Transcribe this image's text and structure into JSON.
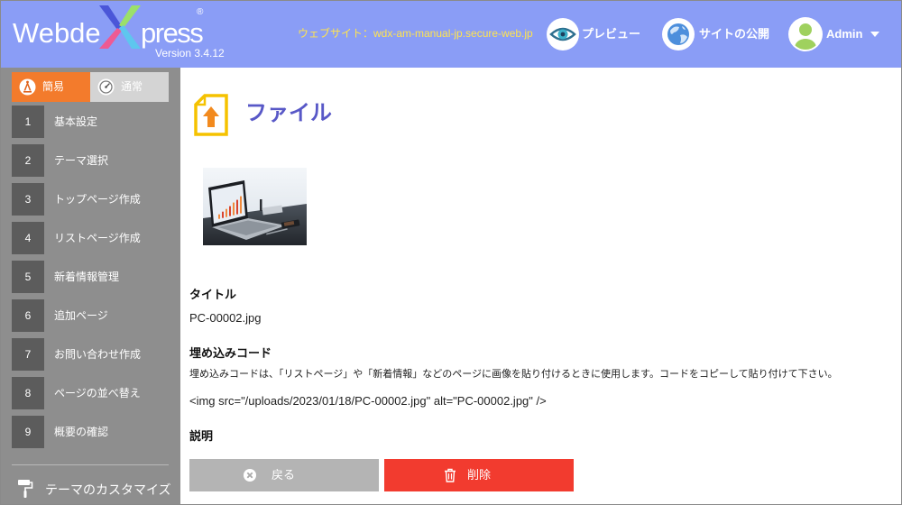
{
  "header": {
    "logo": {
      "left": "Webde",
      "mark": "X",
      "right": "press",
      "trademark": "®",
      "version": "Version 3.4.12"
    },
    "website": "ウェブサイト：wdx-am-manual-jp.secure-web.jp",
    "preview": "プレビュー",
    "publish": "サイトの公開",
    "user": "Admin"
  },
  "sidebar": {
    "modes": [
      {
        "label": "簡易",
        "active": true,
        "icon": "easy-mode-icon"
      },
      {
        "label": "通常",
        "active": false,
        "icon": "normal-mode-icon"
      }
    ],
    "items": [
      {
        "num": "1",
        "label": "基本設定"
      },
      {
        "num": "2",
        "label": "テーマ選択"
      },
      {
        "num": "3",
        "label": "トップページ作成"
      },
      {
        "num": "4",
        "label": "リストページ作成"
      },
      {
        "num": "5",
        "label": "新着情報管理"
      },
      {
        "num": "6",
        "label": "追加ページ"
      },
      {
        "num": "7",
        "label": "お問い合わせ作成"
      },
      {
        "num": "8",
        "label": "ページの並べ替え"
      },
      {
        "num": "9",
        "label": "概要の確認"
      }
    ],
    "customize": {
      "label": "テーマのカスタマイズ",
      "icon": "paint-roller-icon"
    }
  },
  "main": {
    "page_title": "ファイル",
    "page_icon": "file-upload-icon",
    "title_heading": "タイトル",
    "title_value": "PC-00002.jpg",
    "embed_heading": "埋め込みコード",
    "embed_help": "埋め込みコードは、「リストページ」や「新着情報」などのページに画像を貼り付けるときに使用します。コードをコピーして貼り付けて下さい。",
    "embed_code": "<img src=\"/uploads/2023/01/18/PC-00002.jpg\" alt=\"PC-00002.jpg\" />",
    "description_heading": "説明",
    "back_button": "戻る",
    "delete_button": "削除"
  },
  "icons": {
    "preview": "eye-icon",
    "publish": "globe-icon",
    "user": "avatar-icon",
    "user_menu": "caret-down-icon",
    "back": "close-circle-icon",
    "delete": "trash-icon"
  },
  "colors": {
    "header_bg": "#8a9df6",
    "website_text": "#ffe44f",
    "sidebar_bg": "#8e8e8e",
    "step_number_bg": "#5c5c5c",
    "mode_active": "#f37b2c",
    "mode_inactive": "#d4d4d4",
    "page_title": "#5858c7",
    "back_button": "#b4b4b4",
    "delete_button": "#f23b2f"
  }
}
